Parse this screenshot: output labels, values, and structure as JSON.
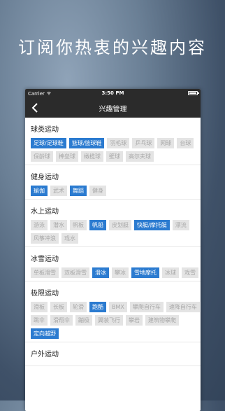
{
  "headline": "订阅你热衷的兴趣内容",
  "status_bar": {
    "carrier": "Carrier",
    "time": "3:50 PM"
  },
  "nav": {
    "title": "兴趣管理"
  },
  "colors": {
    "accent": "#2b7bd0",
    "inactive_bg": "#e4e4e4",
    "inactive_text": "#a8a8a8"
  },
  "sections": [
    {
      "title": "球类运动",
      "tags": [
        {
          "label": "足球/足球鞋",
          "selected": true
        },
        {
          "label": "篮球/篮球鞋",
          "selected": true
        },
        {
          "label": "羽毛球",
          "selected": false
        },
        {
          "label": "乒乓球",
          "selected": false
        },
        {
          "label": "网球",
          "selected": false
        },
        {
          "label": "台球",
          "selected": false
        },
        {
          "label": "保龄球",
          "selected": false
        },
        {
          "label": "棒垒球",
          "selected": false
        },
        {
          "label": "橄榄球",
          "selected": false
        },
        {
          "label": "壁球",
          "selected": false
        },
        {
          "label": "高尔夫球",
          "selected": false
        }
      ]
    },
    {
      "title": "健身运动",
      "tags": [
        {
          "label": "瑜伽",
          "selected": true
        },
        {
          "label": "武术",
          "selected": false
        },
        {
          "label": "舞蹈",
          "selected": true
        },
        {
          "label": "健身",
          "selected": false
        }
      ]
    },
    {
      "title": "水上运动",
      "tags": [
        {
          "label": "游泳",
          "selected": false
        },
        {
          "label": "潜水",
          "selected": false
        },
        {
          "label": "帆板",
          "selected": false
        },
        {
          "label": "帆船",
          "selected": true
        },
        {
          "label": "皮划艇",
          "selected": false
        },
        {
          "label": "快艇/摩托艇",
          "selected": true
        },
        {
          "label": "漂流",
          "selected": false
        },
        {
          "label": "风筝冲浪",
          "selected": false
        },
        {
          "label": "戏水",
          "selected": false
        }
      ]
    },
    {
      "title": "冰雪运动",
      "tags": [
        {
          "label": "单板滑雪",
          "selected": false
        },
        {
          "label": "双板滑雪",
          "selected": false
        },
        {
          "label": "滑冰",
          "selected": true
        },
        {
          "label": "攀冰",
          "selected": false
        },
        {
          "label": "雪地摩托",
          "selected": true
        },
        {
          "label": "冰球",
          "selected": false
        },
        {
          "label": "戏雪",
          "selected": false
        }
      ]
    },
    {
      "title": "极限运动",
      "tags": [
        {
          "label": "滑板",
          "selected": false
        },
        {
          "label": "长板",
          "selected": false
        },
        {
          "label": "轮滑",
          "selected": false
        },
        {
          "label": "跑酷",
          "selected": true
        },
        {
          "label": "BMX",
          "selected": false
        },
        {
          "label": "攀爬自行车",
          "selected": false
        },
        {
          "label": "速降自行车",
          "selected": false
        },
        {
          "label": "跳伞",
          "selected": false
        },
        {
          "label": "滑翔伞",
          "selected": false
        },
        {
          "label": "蹦极",
          "selected": false
        },
        {
          "label": "翼装飞行",
          "selected": false
        },
        {
          "label": "攀岩",
          "selected": false
        },
        {
          "label": "建筑物攀爬",
          "selected": false
        },
        {
          "label": "定向越野",
          "selected": true
        }
      ]
    },
    {
      "title": "户外运动",
      "tags": []
    }
  ]
}
